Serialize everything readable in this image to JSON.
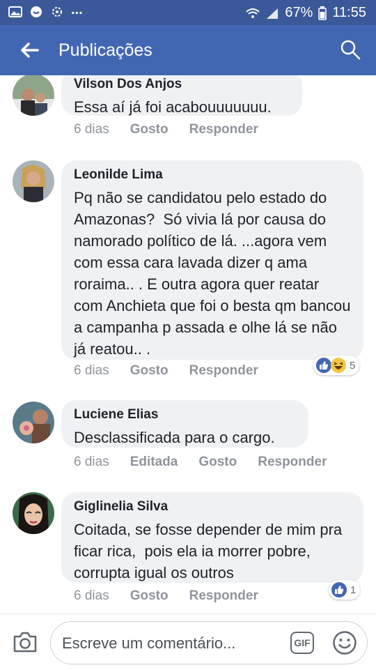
{
  "status_bar": {
    "ellipsis": "...",
    "battery": "67%",
    "time": "11:55"
  },
  "header": {
    "title": "Publicações"
  },
  "comments": [
    {
      "author": "Vilson Dos Anjos",
      "text": "Essa aí já foi acabouuuuuuu.",
      "time": "6 dias",
      "actions": [
        "Gosto",
        "Responder"
      ],
      "reactions": null
    },
    {
      "author": "Leonilde Lima",
      "text": "Pq não se candidatou pelo estado do Amazonas?  Só vivia lá por causa do namorado político de lá. ...agora vem com essa cara lavada dizer q ama roraima.. . E outra agora quer reatar com Anchieta que foi o besta qm bancou a campanha p assada e olhe lá se não já reatou.. .",
      "time": "6 dias",
      "actions": [
        "Gosto",
        "Responder"
      ],
      "reactions": {
        "count": "5",
        "types": [
          "like",
          "haha"
        ]
      }
    },
    {
      "author": "Luciene Elias",
      "text": "Desclassificada para o cargo.",
      "time": "6 dias",
      "actions": [
        "Editada",
        "Gosto",
        "Responder"
      ],
      "reactions": null
    },
    {
      "author": "Giglinelia Silva",
      "text": "Coitada, se fosse depender de mim pra ficar rica,  pois ela ia morrer pobre,  corrupta igual os outros",
      "time": "6 dias",
      "actions": [
        "Gosto",
        "Responder"
      ],
      "reactions": {
        "count": "1",
        "types": [
          "like"
        ]
      }
    }
  ],
  "composer": {
    "placeholder": "Escreve um comentário...",
    "gif_label": "GIF"
  },
  "colors": {
    "status_bar": "#3b5998",
    "app_bar": "#4267b2",
    "bubble": "#f0f1f3",
    "like_blue": "#4267b2",
    "meta_gray": "#90949c"
  }
}
